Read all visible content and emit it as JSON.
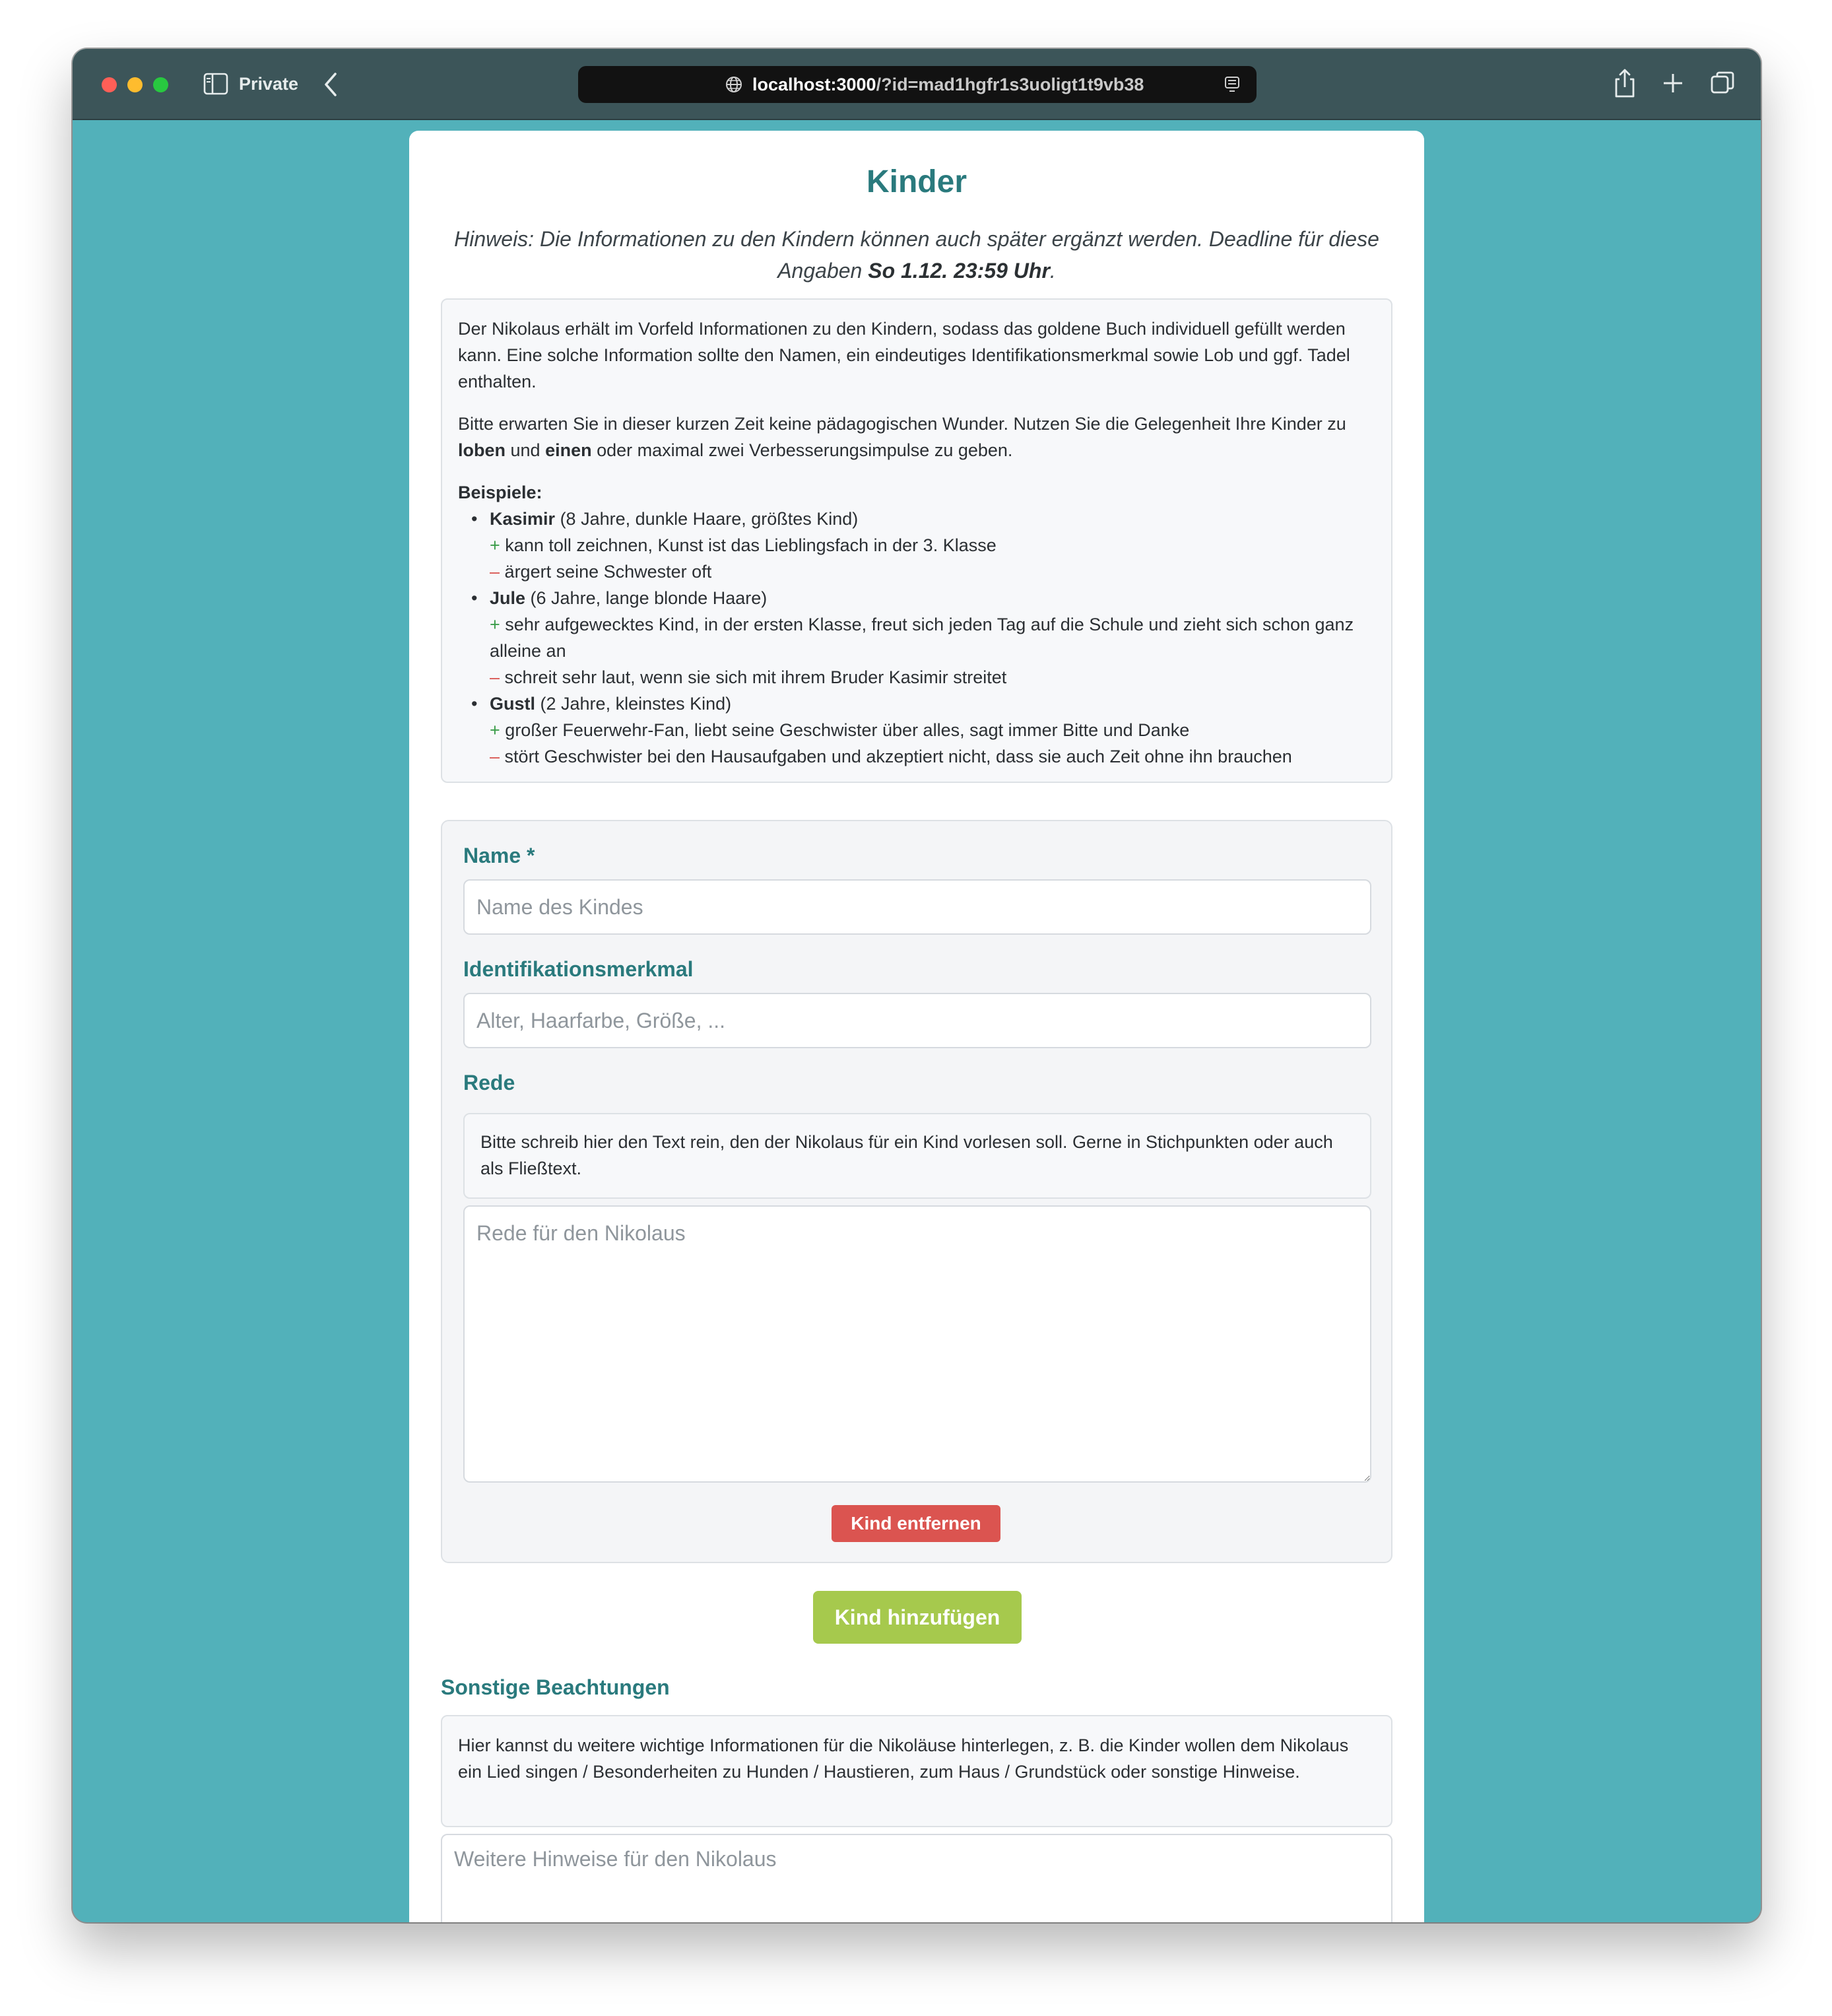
{
  "browser": {
    "private_label": "Private",
    "url_host": "localhost:3000",
    "url_rest": "/?id=mad1hgfr1s3uoligt1t9vb38"
  },
  "page": {
    "title": "Kinder",
    "hint_text": "Hinweis: Die Informationen zu den Kindern können auch später ergänzt werden. Deadline für diese Angaben ",
    "hint_deadline": "So 1.12. 23:59 Uhr",
    "hint_end": "."
  },
  "info": {
    "p1": "Der Nikolaus erhält im Vorfeld Informationen zu den Kindern, sodass das goldene Buch individuell gefüllt werden kann. Eine solche Information sollte den Namen, ein eindeutiges Identifikationsmerkmal sowie Lob und ggf. Tadel enthalten.",
    "p2_a": "Bitte erwarten Sie in dieser kurzen Zeit keine pädagogischen Wunder. Nutzen Sie die Gelegenheit Ihre Kinder zu ",
    "p2_b": "loben",
    "p2_c": " und ",
    "p2_d": "einen",
    "p2_e": " oder maximal zwei Verbesserungsimpulse zu geben.",
    "examples_title": "Beispiele:",
    "examples": [
      {
        "name": "Kasimir",
        "desc": " (8 Jahre, dunkle Haare, größtes Kind)",
        "plus": "kann toll zeichnen, Kunst ist das Lieblingsfach in der 3. Klasse",
        "minus": "ärgert seine Schwester oft"
      },
      {
        "name": "Jule",
        "desc": " (6 Jahre, lange blonde Haare)",
        "plus": "sehr aufgewecktes Kind, in der ersten Klasse, freut sich jeden Tag auf die Schule und zieht sich schon ganz alleine an",
        "minus": "schreit sehr laut, wenn sie sich mit ihrem Bruder Kasimir streitet"
      },
      {
        "name": "Gustl",
        "desc": " (2 Jahre, kleinstes Kind)",
        "plus": "großer Feuerwehr-Fan, liebt seine Geschwister über alles, sagt immer Bitte und Danke",
        "minus": "stört Geschwister bei den Hausaufgaben und akzeptiert nicht, dass sie auch Zeit ohne ihn brauchen"
      }
    ],
    "plus_sign": "+",
    "minus_sign": "–"
  },
  "child_form": {
    "name_label": "Name *",
    "name_placeholder": "Name des Kindes",
    "id_label": "Identifikationsmerkmal",
    "id_placeholder": "Alter, Haarfarbe, Größe, ...",
    "speech_label": "Rede",
    "speech_hint": "Bitte schreib hier den Text rein, den der Nikolaus für ein Kind vorlesen soll. Gerne in Stichpunkten oder auch als Fließtext.",
    "speech_placeholder": "Rede für den Nikolaus",
    "remove_button": "Kind entfernen"
  },
  "add_button": "Kind hinzufügen",
  "other": {
    "title": "Sonstige Beachtungen",
    "hint": "Hier kannst du weitere wichtige Informationen für die Nikoläuse hinterlegen, z. B. die Kinder wollen dem Nikolaus ein Lied singen / Besonderheiten zu Hunden / Haustieren, zum Haus / Grundstück oder sonstige Hinweise.",
    "placeholder": "Weitere Hinweise für den Nikolaus"
  },
  "colors": {
    "background": "#52b1ba",
    "heading": "#2a7a7d",
    "remove_button": "#db5450",
    "add_button": "#a6c94d",
    "plus": "#3a9c49",
    "minus": "#d9534f"
  },
  "icons": {
    "sidebar": "sidebar-icon",
    "back": "chevron-left-icon",
    "url": "globe-icon",
    "reader": "reader-icon",
    "share": "share-icon",
    "new_tab": "plus-icon",
    "tabs": "tabs-overview-icon"
  }
}
